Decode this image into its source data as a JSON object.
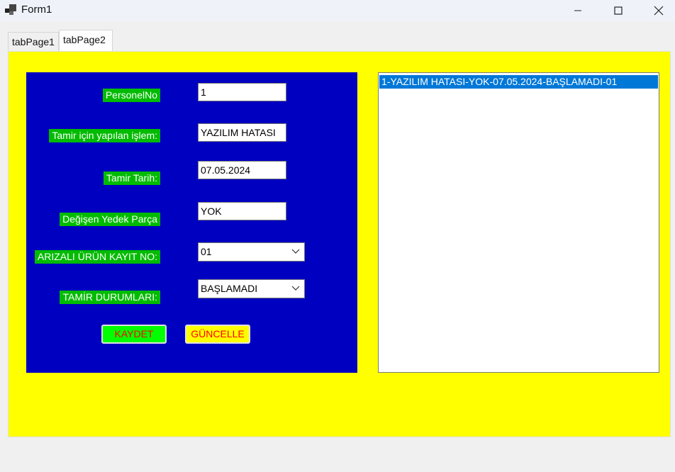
{
  "window": {
    "title": "Form1"
  },
  "tabs": [
    {
      "label": "tabPage1",
      "active": false
    },
    {
      "label": "tabPage2",
      "active": true
    }
  ],
  "form": {
    "labels": {
      "personel_no": "PersonelNo",
      "tamir_islem": "Tamir için yapılan işlem:",
      "tamir_tarih": "Tamir Tarih:",
      "yedek_parca": "Değişen Yedek Parça",
      "arizali_urun": "ARIZALI ÜRÜN KAYIT NO:",
      "tamir_durum": "TAMİR DURUMLARI:"
    },
    "values": {
      "personel_no": "1",
      "tamir_islem": "YAZILIM HATASI",
      "tamir_tarih": "07.05.2024",
      "yedek_parca": "YOK",
      "arizali_urun": "01",
      "tamir_durum": "BAŞLAMADI"
    },
    "buttons": {
      "kaydet": "KAYDET",
      "guncelle": "GÜNCELLE"
    }
  },
  "listbox": {
    "items": [
      "1-YAZILIM HATASI-YOK-07.05.2024-BAŞLAMADI-01"
    ],
    "selected_index": 0
  },
  "colors": {
    "tab_background": "#ffff00",
    "panel_background": "#0000c0",
    "label_background": "#00bb00",
    "kaydet_background": "#00ff00",
    "guncelle_background": "#ffff00",
    "button_text": "#ff0000",
    "selection": "#0078d7"
  }
}
